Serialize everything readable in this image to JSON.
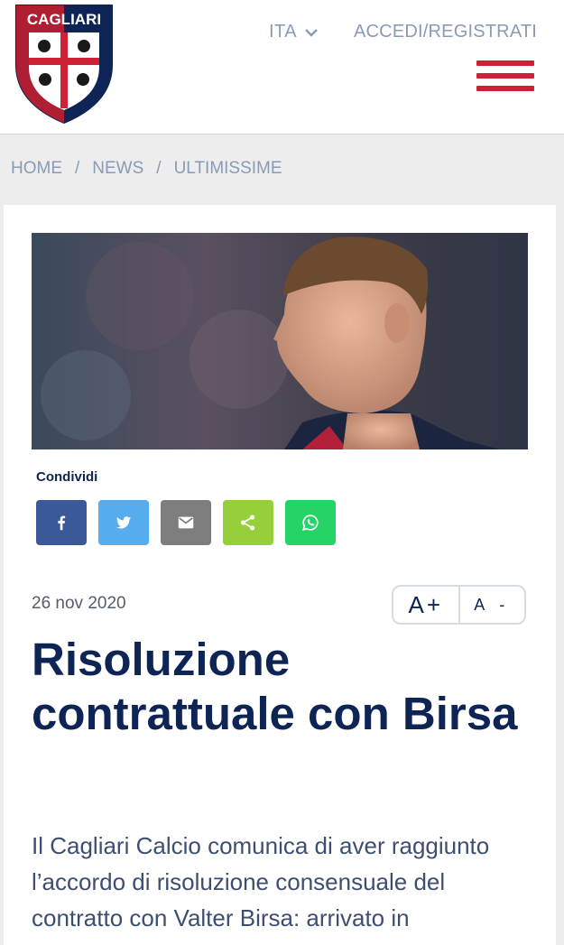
{
  "header": {
    "logo_text": "CAGLIARI",
    "language": "ITA",
    "login_label": "ACCEDI/REGISTRATI"
  },
  "breadcrumb": {
    "home": "HOME",
    "news": "NEWS",
    "current": "ULTIMISSIME",
    "separator": "/"
  },
  "article": {
    "share_label": "Condividi",
    "share_buttons": [
      {
        "icon": "facebook-icon",
        "color": "#3b5998"
      },
      {
        "icon": "twitter-icon",
        "color": "#55acee"
      },
      {
        "icon": "email-icon",
        "color": "#7d7d7d"
      },
      {
        "icon": "share-icon",
        "color": "#95d03a"
      },
      {
        "icon": "whatsapp-icon",
        "color": "#25d366"
      }
    ],
    "date": "26 nov 2020",
    "font_increase": "A+",
    "font_decrease": "A -",
    "title": "Risoluzione contrattuale con Birsa",
    "body": "Il Cagliari Calcio comunica di aver raggiunto l’accordo di risoluzione consensuale del contratto con Valter Birsa: arrivato in"
  },
  "colors": {
    "brand_navy": "#0e2454",
    "brand_red": "#cf2135",
    "muted_text": "#8a9bb5"
  }
}
